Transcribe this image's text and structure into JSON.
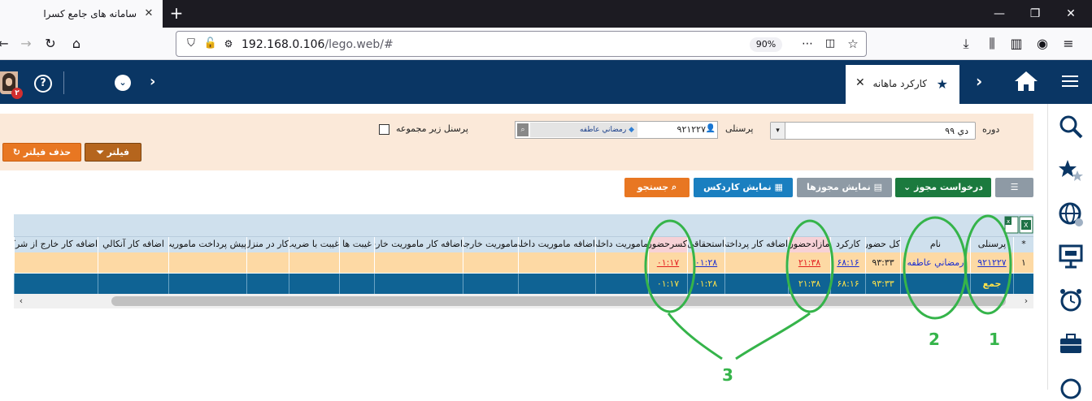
{
  "browser": {
    "tab_title": "سامانه های جامع کسرا",
    "url_host": "192.168.0.106",
    "url_path": "/lego.web/#",
    "zoom": "90%"
  },
  "app": {
    "active_tab": "کارکرد ماهانه",
    "notification_count": "۲",
    "help_label": "?"
  },
  "filter": {
    "period_label": "دوره",
    "period_value": "دي ۹۹",
    "person_label": "پرسنلی",
    "person_code": "۹۲۱۲۲۷",
    "person_name": "رمضاني عاطفه",
    "subgroup_label": "پرسنل زير مجموعه",
    "filter_button": "فیلتر",
    "remove_filter_button": "حذف فیلتر"
  },
  "toolbar": {
    "request_permit": "درخواست مجوز",
    "show_permits": "نمایش مجوزها",
    "show_cardex": "نمایش کاردکس",
    "search": "جستجو"
  },
  "grid": {
    "columns": [
      "*",
      "پرسنلی",
      "نام",
      "کل حضور",
      "کارکرد",
      "مازادحضور",
      "اضافه کار پرداختي",
      "استحقاقی",
      "کسرحضور",
      "ماموريت داخلي",
      "اضافه ماموريت داخلي",
      "ماموريت خارجي",
      "اضافه کار ماموريت خارجي",
      "غيبت ها",
      "غيبت با ضريب",
      "کار در منزل",
      "پيش پرداخت ماموريت",
      "اضافه کار آنکالي",
      "اضافه کار خارج از شرکت"
    ],
    "row1": {
      "index": "۱",
      "code": "۹۲۱۲۲۷",
      "name": "رمضاني عاطفه",
      "total_presence": "۹۳:۳۳",
      "work": "۶۸:۱۶",
      "surplus": "۲۱:۳۸",
      "entitled": "۰۱:۲۸",
      "deficit": "۰۱:۱۷"
    },
    "total_row": {
      "label": "جمع",
      "total_presence": "۹۳:۳۳",
      "work": "۶۸:۱۶",
      "surplus": "۲۱:۳۸",
      "entitled": "۰۱:۲۸",
      "deficit": "۰۱:۱۷"
    }
  },
  "annotations": [
    "1",
    "2",
    "3"
  ],
  "colors": {
    "header_bg": "#0a3664",
    "filter_bg": "#fbe9d9",
    "orange": "#e87722",
    "green": "#1b7a3e",
    "blue": "#1a7fc0",
    "annotation": "#35b44a"
  }
}
